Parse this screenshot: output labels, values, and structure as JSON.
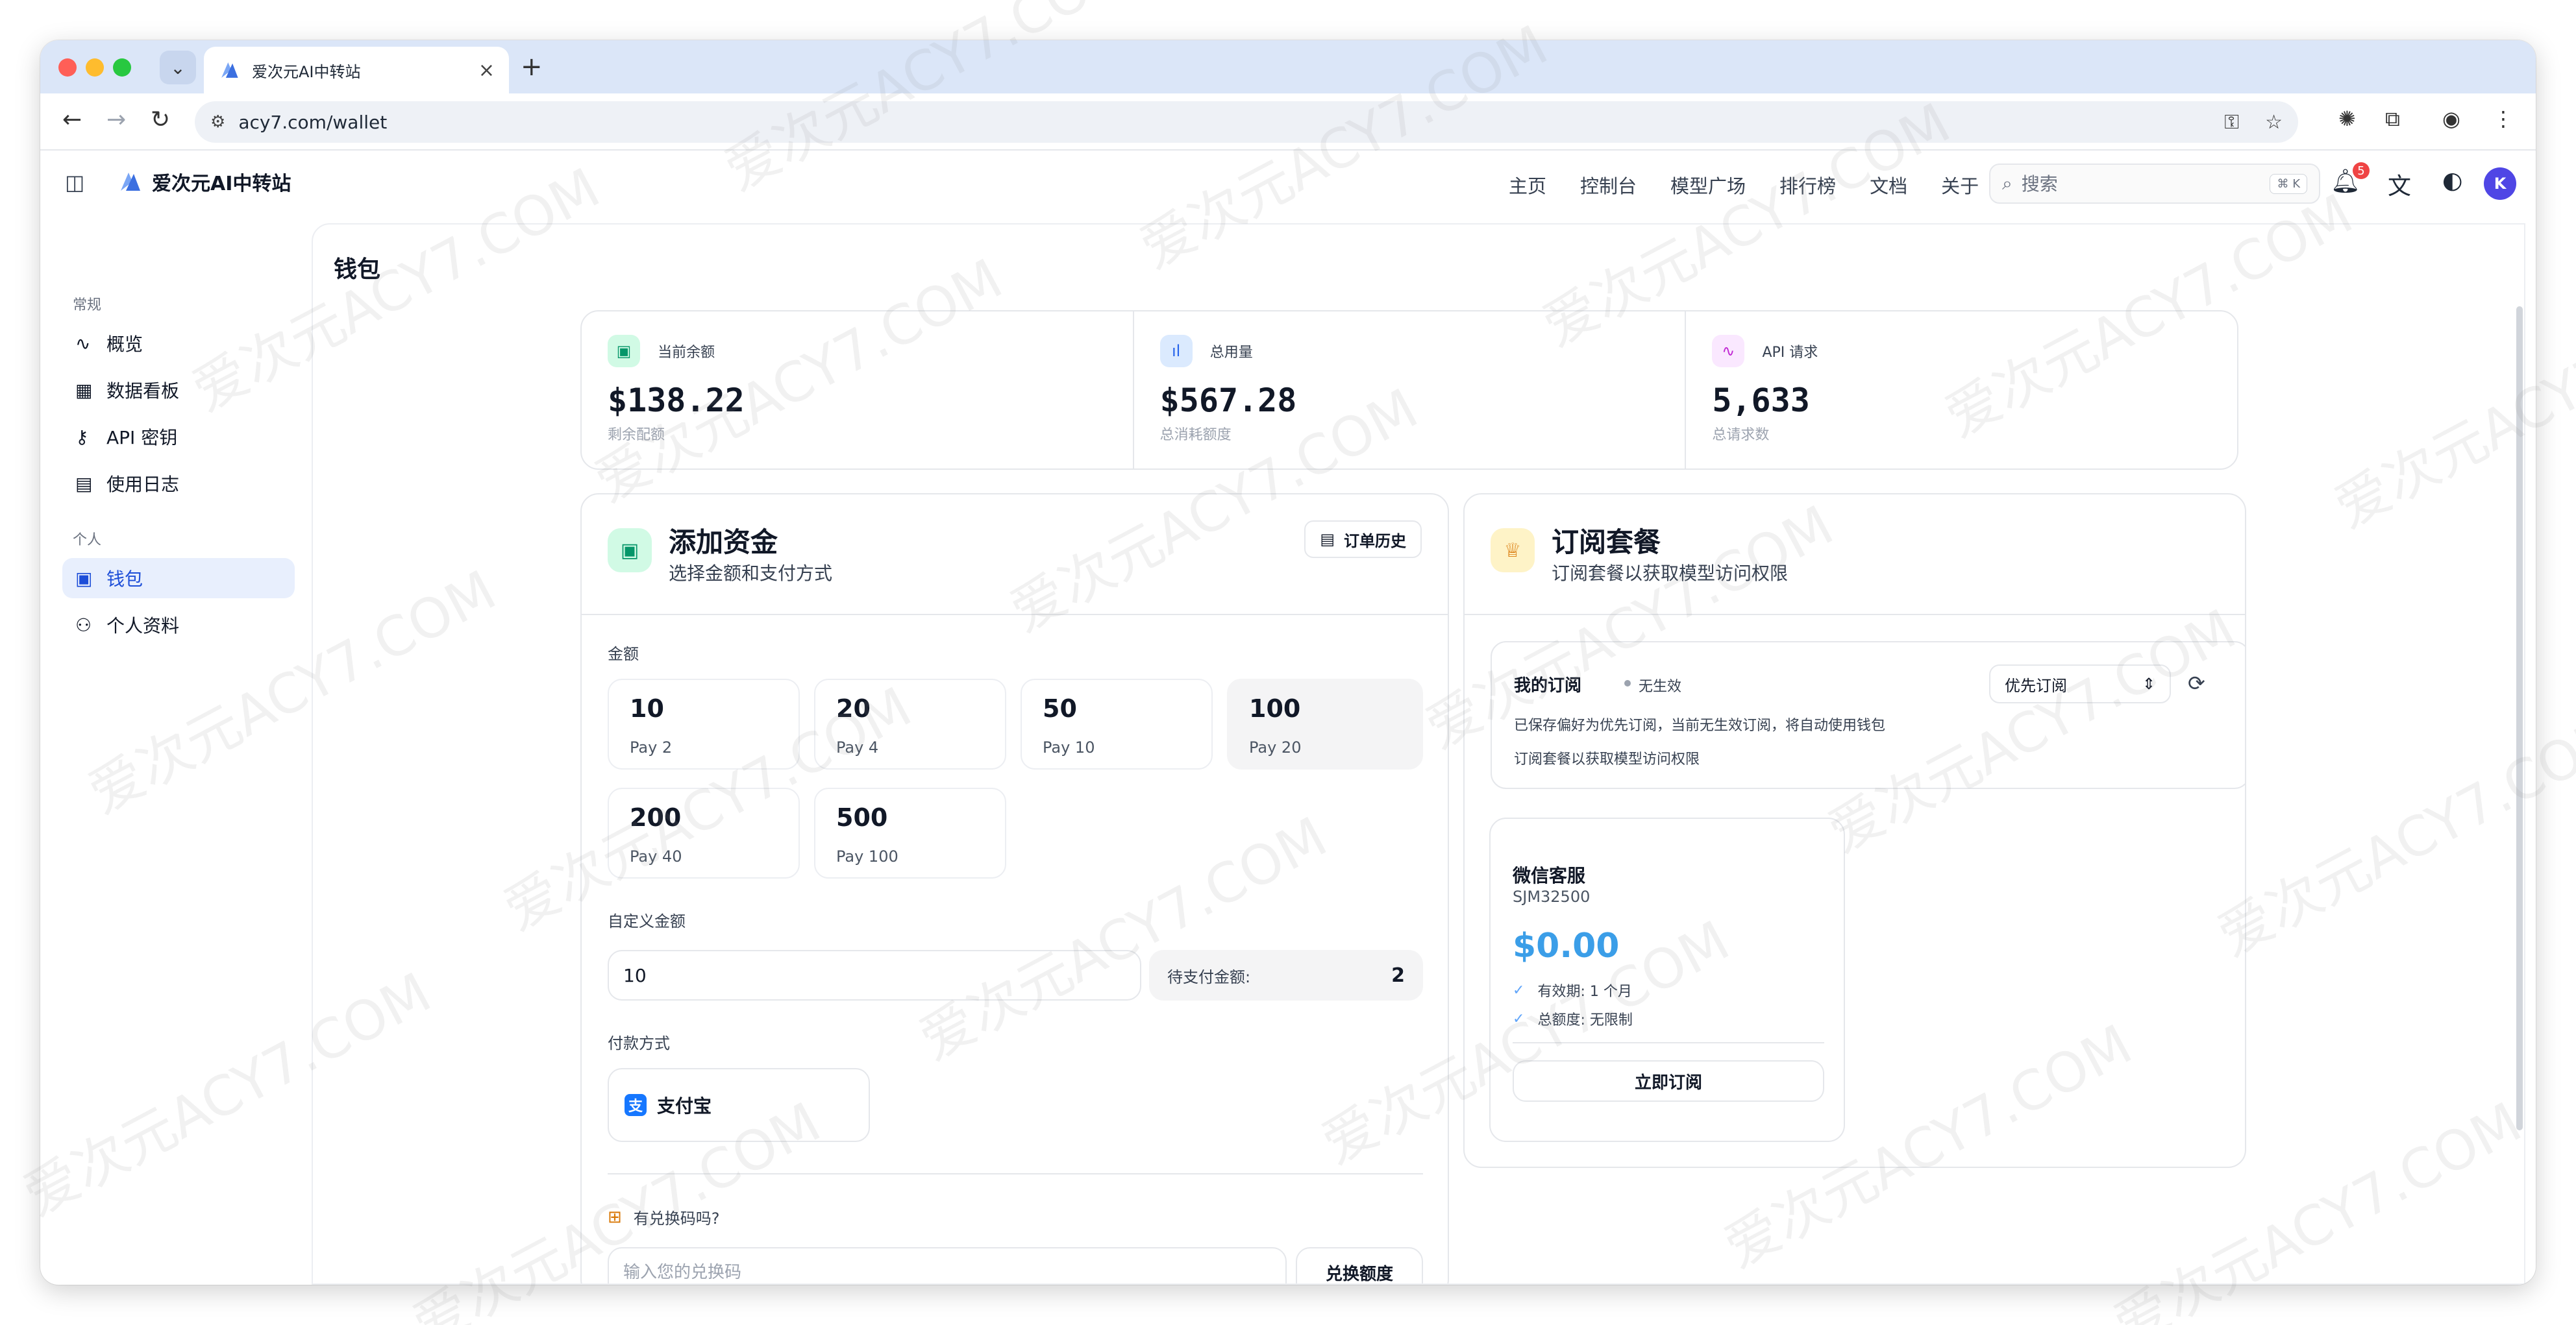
{
  "browser": {
    "tab_title": "爱次元AI中转站",
    "new_tab": "+",
    "url": "acy7.com/wallet"
  },
  "header": {
    "brand": "爱次元AI中转站",
    "nav": [
      "主页",
      "控制台",
      "模型广场",
      "排行榜",
      "文档",
      "关于"
    ],
    "search_placeholder": "搜索",
    "search_shortcut": "⌘ K",
    "notification_count": "5",
    "avatar_letter": "K"
  },
  "sidebar": {
    "group_general": "常规",
    "items_general": [
      {
        "label": "概览",
        "icon": "activity-icon"
      },
      {
        "label": "数据看板",
        "icon": "dashboard-icon"
      },
      {
        "label": "API 密钥",
        "icon": "key-icon"
      },
      {
        "label": "使用日志",
        "icon": "log-icon"
      }
    ],
    "group_personal": "个人",
    "items_personal": [
      {
        "label": "钱包",
        "icon": "wallet-icon",
        "active": true
      },
      {
        "label": "个人资料",
        "icon": "user-icon"
      }
    ]
  },
  "page": {
    "title": "钱包"
  },
  "stats": [
    {
      "label": "当前余额",
      "value": "$138.22",
      "sub": "剩余配额",
      "color": "#10b981"
    },
    {
      "label": "总用量",
      "value": "$567.28",
      "sub": "总消耗额度",
      "color": "#3b82f6"
    },
    {
      "label": "API 请求",
      "value": "5,633",
      "sub": "总请求数",
      "color": "#d946ef"
    }
  ],
  "add_funds": {
    "title": "添加资金",
    "subtitle": "选择金额和支付方式",
    "order_history": "订单历史",
    "amount_label": "金额",
    "amounts": [
      {
        "value": "10",
        "pay": "Pay 2"
      },
      {
        "value": "20",
        "pay": "Pay 4"
      },
      {
        "value": "50",
        "pay": "Pay 10"
      },
      {
        "value": "100",
        "pay": "Pay 20",
        "selected": true
      },
      {
        "value": "200",
        "pay": "Pay 40"
      },
      {
        "value": "500",
        "pay": "Pay 100"
      }
    ],
    "custom_label": "自定义金额",
    "custom_value": "10",
    "pending_label": "待支付金额:",
    "pending_value": "2",
    "payment_label": "付款方式",
    "payment_method": "支付宝",
    "redeem_question": "有兑换码吗?",
    "redeem_placeholder": "输入您的兑换码",
    "redeem_button": "兑换额度"
  },
  "subscription": {
    "title": "订阅套餐",
    "subtitle": "订阅套餐以获取模型访问权限",
    "my_sub_title": "我的订阅",
    "my_sub_status": "无生效",
    "priority_select": "优先订阅",
    "line1": "已保存偏好为优先订阅，当前无生效订阅，将自动使用钱包",
    "line2": "订阅套餐以获取模型访问权限",
    "plan": {
      "name": "微信客服",
      "code": "SJM32500",
      "price": "$0.00",
      "feature1": "有效期: 1 个月",
      "feature2": "总额度: 无限制",
      "button": "立即订阅"
    }
  },
  "watermark": "爱次元ACY7.COM"
}
